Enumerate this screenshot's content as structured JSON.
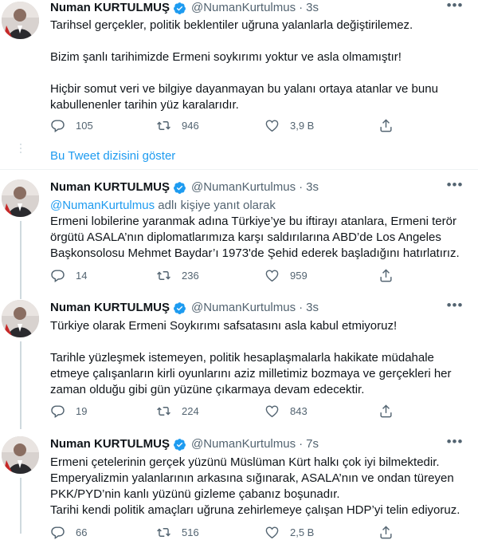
{
  "tweets": [
    {
      "name": "Numan KURTULMUŞ",
      "handle": "@NumanKurtulmus",
      "time": "3s",
      "paragraphs": [
        "Tarihsel gerçekler, politik beklentiler uğruna yalanlarla değiştirilemez.",
        "Bizim şanlı tarihimizde Ermeni soykırımı yoktur ve asla olmamıştır!",
        "Hiçbir somut veri ve bilgiye dayanmayan bu yalanı ortaya atanlar ve bunu kabullenenler tarihin yüz karalarıdır."
      ],
      "replies": "105",
      "retweets": "946",
      "likes": "3,9 B"
    },
    {
      "name": "Numan KURTULMUŞ",
      "handle": "@NumanKurtulmus",
      "time": "3s",
      "reply_to_handle": "@NumanKurtulmus",
      "reply_to_suffix": " adlı kişiye yanıt olarak",
      "paragraphs": [
        "Ermeni lobilerine yaranmak adına Türkiye’ye bu iftirayı atanlara, Ermeni terör örgütü ASALA’nın diplomatlarımıza karşı saldırılarına ABD’de Los Angeles Başkonsolosu Mehmet Baydar’ı 1973'de Şehid ederek başladığını hatırlatırız."
      ],
      "replies": "14",
      "retweets": "236",
      "likes": "959"
    },
    {
      "name": "Numan KURTULMUŞ",
      "handle": "@NumanKurtulmus",
      "time": "3s",
      "paragraphs": [
        "Türkiye olarak Ermeni Soykırımı safsatasını asla kabul etmiyoruz!",
        "Tarihle yüzleşmek istemeyen, politik hesaplaşmalarla hakikate müdahale etmeye çalışanların kirli oyunlarını aziz milletimiz bozmaya ve gerçekleri her zaman olduğu gibi gün yüzüne çıkarmaya devam edecektir."
      ],
      "replies": "19",
      "retweets": "224",
      "likes": "843"
    },
    {
      "name": "Numan KURTULMUŞ",
      "handle": "@NumanKurtulmus",
      "time": "7s",
      "lines": [
        "Ermeni çetelerinin gerçek yüzünü Müslüman Kürt halkı çok iyi bilmektedir.",
        "Emperyalizmin yalanlarının arkasına sığınarak, ASALA’nın ve ondan türeyen PKK/PYD’nin kanlı yüzünü gizleme çabanız boşunadır.",
        "Tarihi kendi politik amaçları uğruna zehirlemeye çalışan HDP’yi telin ediyoruz."
      ],
      "replies": "66",
      "retweets": "516",
      "likes": "2,5 B"
    }
  ],
  "show_thread_label": "Bu Tweet dizisini göster",
  "colors": {
    "accent": "#1d9bf0",
    "secondary_text": "#536471",
    "thread_line": "#cfd9de",
    "verified": "#1d9bf0"
  },
  "icons": [
    "verified-badge-icon",
    "more-icon",
    "reply-icon",
    "retweet-icon",
    "like-icon",
    "share-icon"
  ]
}
